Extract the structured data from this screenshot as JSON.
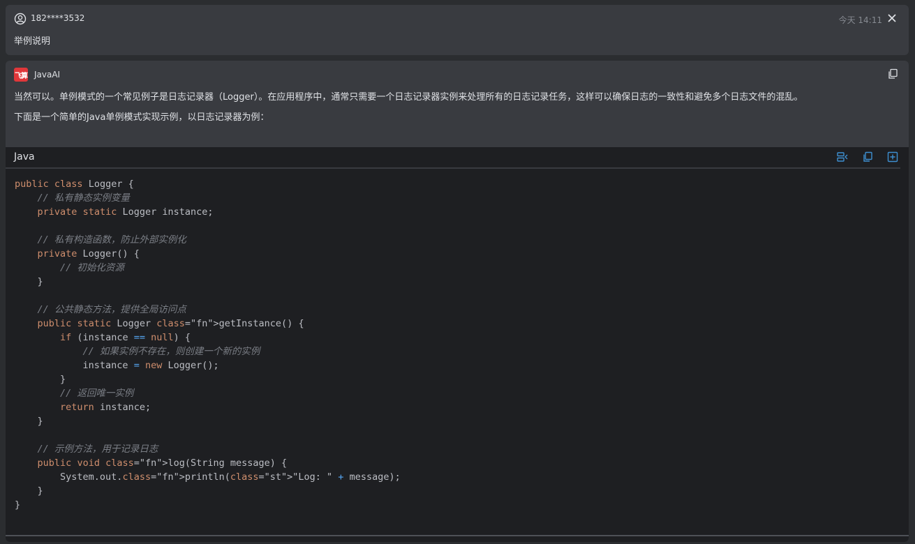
{
  "user_message": {
    "username": "182****3532",
    "timestamp": "今天 14:11",
    "text": "举例说明",
    "icons": [
      "user-circle-icon",
      "close-icon"
    ]
  },
  "ai_message": {
    "assistant_name": "JavaAI",
    "logo_text": "飞算",
    "paragraphs": [
      "当然可以。单例模式的一个常见例子是日志记录器（Logger）。在应用程序中，通常只需要一个日志记录器实例来处理所有的日志记录任务，这样可以确保日志的一致性和避免多个日志文件的混乱。",
      "下面是一个简单的Java单例模式实现示例，以日志记录器为例："
    ],
    "icons": [
      "copy-icon"
    ]
  },
  "code_block": {
    "language": "Java",
    "toolbar_icons": [
      "insert-at-cursor-icon",
      "copy-code-icon",
      "new-file-icon"
    ],
    "lines": [
      "public class Logger {",
      "    // 私有静态实例变量",
      "    private static Logger instance;",
      "",
      "    // 私有构造函数，防止外部实例化",
      "    private Logger() {",
      "        // 初始化资源",
      "    }",
      "",
      "    // 公共静态方法，提供全局访问点",
      "    public static Logger getInstance() {",
      "        if (instance == null) {",
      "            // 如果实例不存在，则创建一个新的实例",
      "            instance = new Logger();",
      "        }",
      "        // 返回唯一实例",
      "        return instance;",
      "    }",
      "",
      "    // 示例方法，用于记录日志",
      "    public void log(String message) {",
      "        System.out.println(\"Log: \" + message);",
      "    }",
      "}"
    ]
  },
  "colors": {
    "background": "#2b2d30",
    "card": "#393b40",
    "code_bg": "#1e1f22",
    "keyword": "#cf8e6d",
    "comment": "#7a7e85",
    "function": "#56a8f5",
    "string": "#6aab73",
    "brand": "#e0373a",
    "toolbar_icon": "#3d8fd1"
  }
}
